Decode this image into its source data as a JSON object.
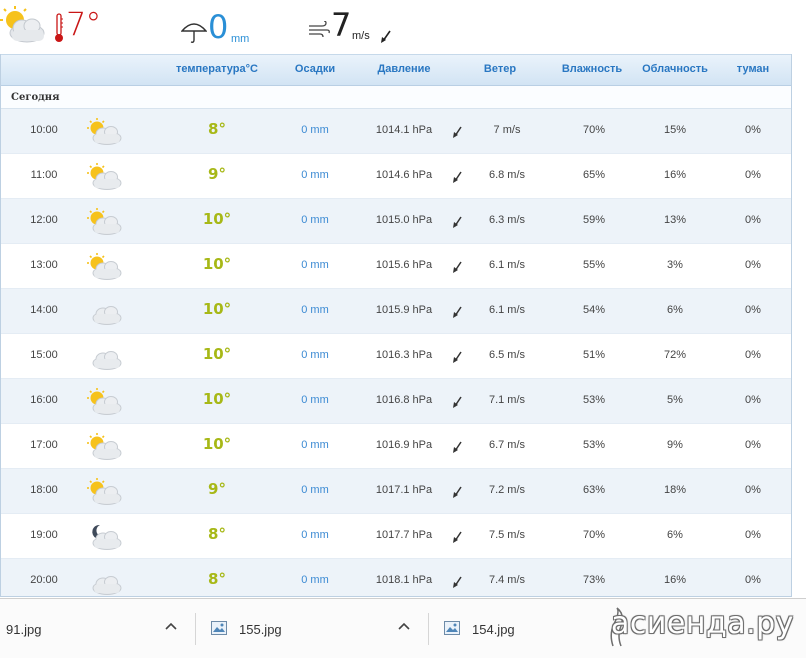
{
  "current": {
    "temperature": "7°",
    "precipitation": "0",
    "precipitation_unit": "mm",
    "wind_speed": "7",
    "wind_unit": "m/s",
    "icons": [
      "partly-cloudy-icon",
      "thermometer-icon",
      "umbrella-icon",
      "wind-icon",
      "wind-direction-arrow-icon"
    ]
  },
  "table": {
    "headers": {
      "temperature": "температура°C",
      "precipitation": "Осадки",
      "pressure": "Давление",
      "wind": "Ветер",
      "humidity": "Влажность",
      "cloudiness": "Облачность",
      "fog": "туман"
    },
    "section_label": "Сегодня",
    "rows": [
      {
        "time": "10:00",
        "icon": "partly-cloudy",
        "temp": "8°",
        "precip": "0 mm",
        "pressure": "1014.1 hPa",
        "wind": "7 m/s",
        "humidity": "70%",
        "cloud": "15%",
        "fog": "0%"
      },
      {
        "time": "11:00",
        "icon": "partly-cloudy",
        "temp": "9°",
        "precip": "0 mm",
        "pressure": "1014.6 hPa",
        "wind": "6.8 m/s",
        "humidity": "65%",
        "cloud": "16%",
        "fog": "0%"
      },
      {
        "time": "12:00",
        "icon": "partly-cloudy",
        "temp": "10°",
        "precip": "0 mm",
        "pressure": "1015.0 hPa",
        "wind": "6.3 m/s",
        "humidity": "59%",
        "cloud": "13%",
        "fog": "0%"
      },
      {
        "time": "13:00",
        "icon": "partly-cloudy",
        "temp": "10°",
        "precip": "0 mm",
        "pressure": "1015.6 hPa",
        "wind": "6.1 m/s",
        "humidity": "55%",
        "cloud": "3%",
        "fog": "0%"
      },
      {
        "time": "14:00",
        "icon": "cloudy",
        "temp": "10°",
        "precip": "0 mm",
        "pressure": "1015.9 hPa",
        "wind": "6.1 m/s",
        "humidity": "54%",
        "cloud": "6%",
        "fog": "0%"
      },
      {
        "time": "15:00",
        "icon": "cloudy",
        "temp": "10°",
        "precip": "0 mm",
        "pressure": "1016.3 hPa",
        "wind": "6.5 m/s",
        "humidity": "51%",
        "cloud": "72%",
        "fog": "0%"
      },
      {
        "time": "16:00",
        "icon": "partly-cloudy",
        "temp": "10°",
        "precip": "0 mm",
        "pressure": "1016.8 hPa",
        "wind": "7.1 m/s",
        "humidity": "53%",
        "cloud": "5%",
        "fog": "0%"
      },
      {
        "time": "17:00",
        "icon": "partly-cloudy",
        "temp": "10°",
        "precip": "0 mm",
        "pressure": "1016.9 hPa",
        "wind": "6.7 m/s",
        "humidity": "53%",
        "cloud": "9%",
        "fog": "0%"
      },
      {
        "time": "18:00",
        "icon": "partly-cloudy",
        "temp": "9°",
        "precip": "0 mm",
        "pressure": "1017.1 hPa",
        "wind": "7.2 m/s",
        "humidity": "63%",
        "cloud": "18%",
        "fog": "0%"
      },
      {
        "time": "19:00",
        "icon": "night-cloudy",
        "temp": "8°",
        "precip": "0 mm",
        "pressure": "1017.7 hPa",
        "wind": "7.5 m/s",
        "humidity": "70%",
        "cloud": "6%",
        "fog": "0%"
      },
      {
        "time": "20:00",
        "icon": "cloudy",
        "temp": "8°",
        "precip": "0 mm",
        "pressure": "1018.1 hPa",
        "wind": "7.4 m/s",
        "humidity": "73%",
        "cloud": "16%",
        "fog": "0%"
      }
    ]
  },
  "downloads": {
    "items": [
      {
        "name": "91.jpg",
        "icon": "image-file-icon"
      },
      {
        "name": "155.jpg",
        "icon": "image-file-icon"
      },
      {
        "name": "154.jpg",
        "icon": "image-file-icon"
      }
    ]
  },
  "watermark": "асиенда.ру",
  "colors": {
    "current_temp": "#c91616",
    "precip": "#2a8fd6",
    "hour_temp": "#a7b817",
    "header_text": "#2977c2",
    "row_alt": "#edf3f9"
  }
}
